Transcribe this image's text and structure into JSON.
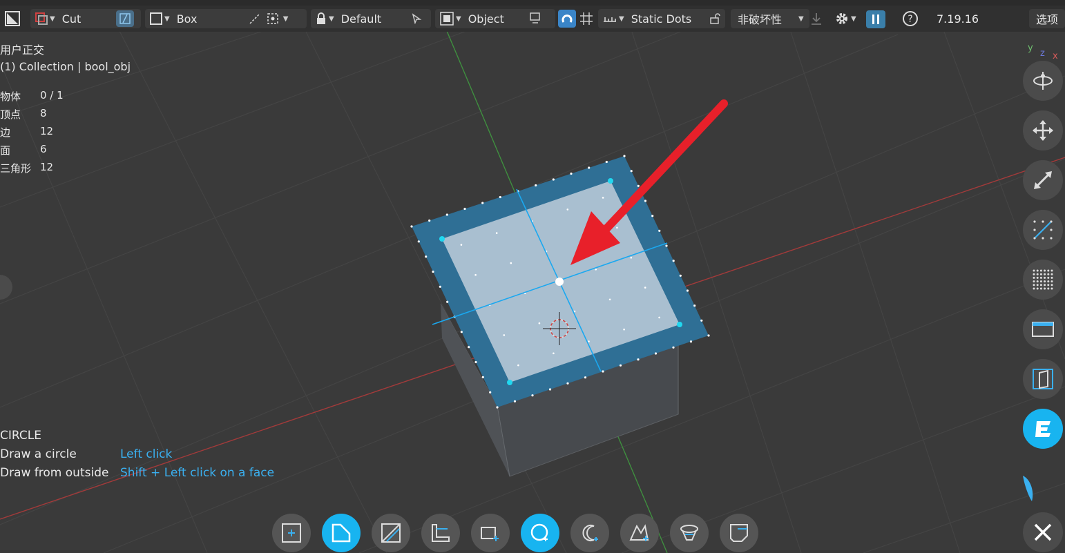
{
  "header": {
    "mode": "Cut",
    "shape": "Box",
    "alignment": "Default",
    "target": "Object",
    "display": "Static Dots",
    "boolean_mode": "非破坏性",
    "version": "7.19.16",
    "options": "选项",
    "help_icon": "question-icon"
  },
  "overlay": {
    "view_name": "用户正交",
    "collection": "(1) Collection | bool_obj",
    "stats": [
      {
        "label": "物体",
        "value": "0 / 1"
      },
      {
        "label": "顶点",
        "value": "8"
      },
      {
        "label": "边",
        "value": "12"
      },
      {
        "label": "面",
        "value": "6"
      },
      {
        "label": "三角形",
        "value": "12"
      }
    ]
  },
  "hints": {
    "title": "CIRCLE",
    "rows": [
      {
        "key": "Draw a circle",
        "value": "Left click"
      },
      {
        "key": "Draw from outside",
        "value": "Shift + Left click on a face"
      }
    ]
  },
  "gizmo_axes": {
    "y": "y",
    "z": "z",
    "x": "x"
  },
  "colors": {
    "accent": "#18b4f0",
    "arrow": "#e8202a",
    "face_border": "#2f6f95",
    "face_fill": "#a9bfd0",
    "grid_x": "#b03434",
    "grid_y": "#3d9a3d"
  },
  "right_tools": [
    "orbit-icon",
    "move-icon",
    "scale-icon",
    "grid-line-icon",
    "dot-grid-icon",
    "frame-icon",
    "panel-icon",
    "e-logo-icon"
  ],
  "bottom_tools": [
    "add-box-icon",
    "cut-slice-icon",
    "slice-icon",
    "corner-icon",
    "box-add-icon",
    "circle-icon",
    "circle-add-icon",
    "ngon-icon",
    "rotate-icon",
    "knife-icon"
  ]
}
